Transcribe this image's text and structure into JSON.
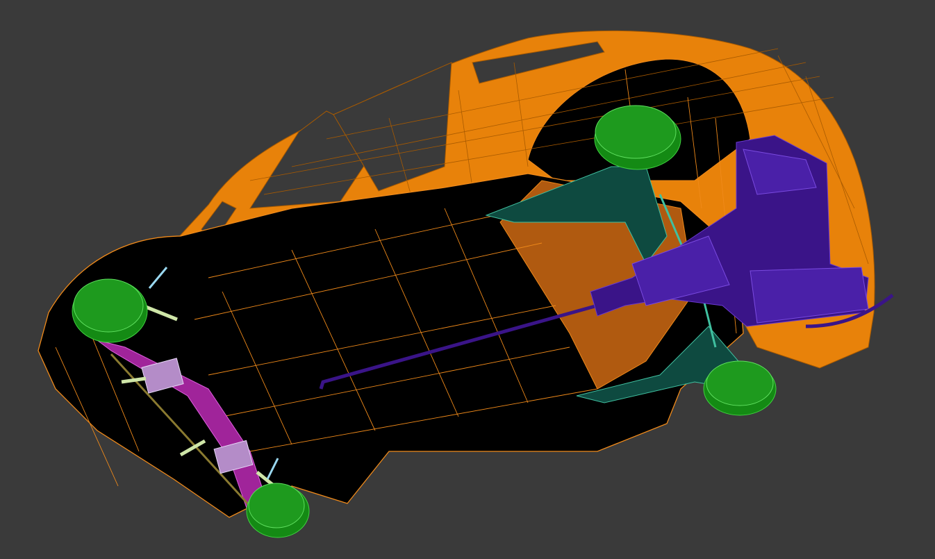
{
  "viewport": {
    "background": "#3a3a3a"
  },
  "scene": {
    "parts": [
      {
        "id": "body-shell",
        "color": "#e8820a",
        "render": "wireframe-shaded"
      },
      {
        "id": "floor-pan",
        "color": "#000000",
        "edges": "#f08a1a"
      },
      {
        "id": "wheels",
        "color": "#1e9a1e",
        "count": 4
      },
      {
        "id": "rear-axle-beam",
        "color": "#a0249a"
      },
      {
        "id": "leaf-spring-clamps",
        "color": "#b48cc8"
      },
      {
        "id": "front-control-arms",
        "color": "#0e4a40"
      },
      {
        "id": "engine-gearbox",
        "color": "#3a1488"
      },
      {
        "id": "drive-shaft",
        "color": "#3a1488"
      },
      {
        "id": "shock-absorbers",
        "color": "#cfe6a8"
      },
      {
        "id": "exhaust-pipe",
        "color": "#3a1488"
      }
    ]
  }
}
